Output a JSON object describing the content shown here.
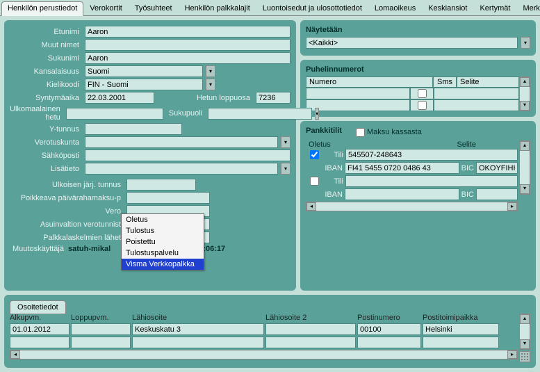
{
  "tabs": [
    "Henkilön perustiedot",
    "Verokortit",
    "Työsuhteet",
    "Henkilön palkkalajit",
    "Luontoisedut ja ulosottotiedot",
    "Lomaoikeus",
    "Keskiansiot",
    "Kertymät",
    "Merkkipäivät"
  ],
  "active_tab": 0,
  "fields": {
    "etunimi_label": "Etunimi",
    "etunimi": "Aaron",
    "muutnimet_label": "Muut nimet",
    "muutnimet": "",
    "sukunimi_label": "Sukunimi",
    "sukunimi": "Aaron",
    "kansalaisuus_label": "Kansalaisuus",
    "kansalaisuus": "Suomi",
    "kielikoodi_label": "Kielikoodi",
    "kielikoodi": "FIN - Suomi",
    "syntyma_label": "Syntymäaika",
    "syntyma": "22.03.2001",
    "hetun_label": "Hetun loppuosa",
    "hetun": "7236",
    "ulkhetu_label": "Ulkomaalainen hetu",
    "ulkhetu": "",
    "sukupuoli_label": "Sukupuoli",
    "sukupuoli": "",
    "ytunnus_label": "Y-tunnus",
    "ytunnus": "",
    "verotuskunta_label": "Verotuskunta",
    "verotuskunta": "",
    "sahkoposti_label": "Sähköposti",
    "sahkoposti": "",
    "lisatieto_label": "Lisätieto",
    "lisatieto": "",
    "ulkoisen_label": "Ulkoisen järj. tunnus",
    "ulkoisen": "",
    "poikkeava_label": "Poikkeava päivärahamaksu-p",
    "vero_label": "Vero",
    "asuinvaltion_label": "Asuinvaltion verotunnist",
    "palkkalask_label": "Palkkalaskelmien lähet",
    "muutos_label": "Muutoskäyttäjä",
    "muutos_user": "satuh-mikal",
    "muutos_date": "03.04.2019 10:06:17"
  },
  "popup": {
    "items": [
      "Oletus",
      "Tulostus",
      "Poistettu",
      "Tulostuspalvelu",
      "Visma Verkkopalkka"
    ],
    "selected": 4
  },
  "naytetaan": {
    "title": "Näytetään",
    "value": "<Kaikki>"
  },
  "phones": {
    "title": "Puhelinnumerot",
    "headers": {
      "numero": "Numero",
      "sms": "Sms",
      "selite": "Selite"
    }
  },
  "bank": {
    "title": "Pankkitilit",
    "maksu_label": "Maksu kassasta",
    "maksu_checked": false,
    "oletus_header": "Oletus",
    "selite_header": "Selite",
    "tili_label": "Tili",
    "iban_label": "IBAN",
    "bic_label": "BIC",
    "rows": [
      {
        "oletus": true,
        "tili": "545507-248643",
        "iban": "FI41 5455 0720 0486 43",
        "bic": "OKOYFIHH"
      },
      {
        "oletus": false,
        "tili": "",
        "iban": "",
        "bic": ""
      }
    ]
  },
  "address": {
    "tab_title": "Osoitetiedot",
    "headers": {
      "alkupvm": "Alkupvm.",
      "loppupvm": "Loppupvm.",
      "lahiosoite": "Lähiosoite",
      "lahiosoite2": "Lähiosoite 2",
      "postinumero": "Postinumero",
      "postitoimipaikka": "Postitoimipaikka"
    },
    "rows": [
      {
        "alkupvm": "01.01.2012",
        "loppupvm": "",
        "lahiosoite": "Keskuskatu 3",
        "lahiosoite2": "",
        "postinumero": "00100",
        "postitoimipaikka": "Helsinki"
      },
      {
        "alkupvm": "",
        "loppupvm": "",
        "lahiosoite": "",
        "lahiosoite2": "",
        "postinumero": "",
        "postitoimipaikka": ""
      }
    ]
  }
}
